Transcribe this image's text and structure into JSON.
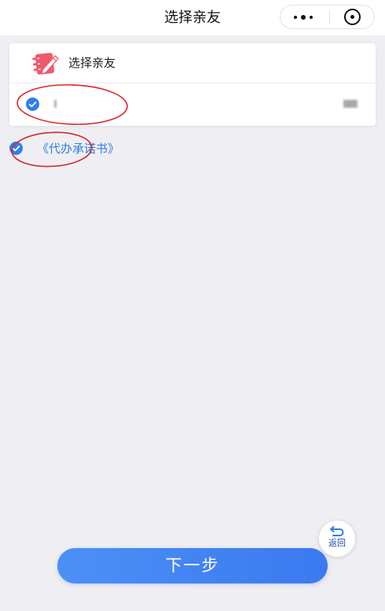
{
  "navbar": {
    "title": "选择亲友",
    "more_icon": "more-dots-icon",
    "close_icon": "target-circle-icon"
  },
  "card": {
    "header_icon": "notebook-pencil-icon",
    "header_label": "选择亲友",
    "relatives": [
      {
        "checked": true
      }
    ]
  },
  "agreement": {
    "checked": true,
    "link_text": "《代办承诺书》"
  },
  "back_button": {
    "icon": "return-arrow-icon",
    "label": "返回"
  },
  "next_button": {
    "label": "下一步"
  },
  "colors": {
    "accent": "#2f7fec",
    "background": "#efeff3",
    "link": "#2b7de9",
    "header_icon": "#f0586c",
    "annotation": "#d9262c"
  }
}
